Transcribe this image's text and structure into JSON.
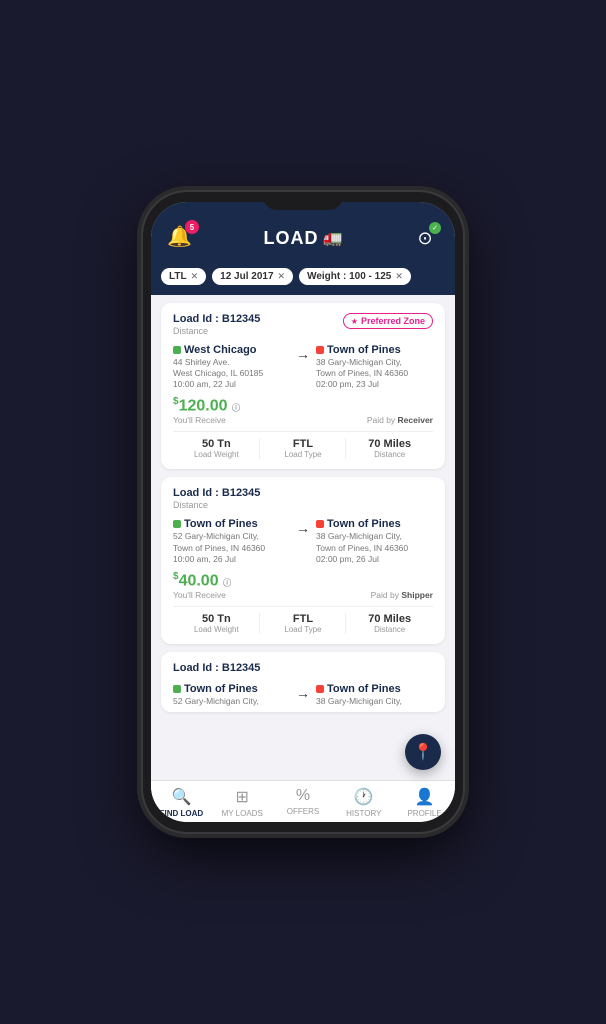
{
  "header": {
    "notification_count": "5",
    "logo_text": "LOAD",
    "filter_active": true
  },
  "filter_pills": [
    {
      "id": "ltl",
      "label": "LTL"
    },
    {
      "id": "date",
      "label": "12 Jul 2017"
    },
    {
      "id": "weight",
      "label": "Weight : 100 - 125"
    }
  ],
  "loads": [
    {
      "id": "load-1",
      "load_id_label": "Load Id : B12345",
      "distance_label": "Distance",
      "preferred_zone": true,
      "preferred_zone_label": "Preferred Zone",
      "origin": {
        "city": "West Chicago",
        "address_line1": "44 Shirley Ave.",
        "address_line2": "West Chicago, IL 60185",
        "time": "10:00 am, 22 Jul"
      },
      "destination": {
        "city": "Town of Pines",
        "address_line1": "38 Gary-Michigan City,",
        "address_line2": "Town of Pines, IN 46360",
        "time": "02:00 pm, 23 Jul"
      },
      "price": "120.00",
      "price_label": "You'll Receive",
      "paid_by": "Receiver",
      "weight": "50 Tn",
      "weight_label": "Load Weight",
      "load_type": "FTL",
      "load_type_label": "Load Type",
      "distance": "70 Miles"
    },
    {
      "id": "load-2",
      "load_id_label": "Load Id : B12345",
      "distance_label": "Distance",
      "preferred_zone": false,
      "origin": {
        "city": "Town of Pines",
        "address_line1": "52 Gary-Michigan City,",
        "address_line2": "Town of Pines, IN 46360",
        "time": "10:00 am, 26 Jul"
      },
      "destination": {
        "city": "Town of Pines",
        "address_line1": "38 Gary-Michigan City,",
        "address_line2": "Town of Pines, IN 46360",
        "time": "02:00 pm, 26 Jul"
      },
      "price": "40.00",
      "price_label": "You'll Receive",
      "paid_by": "Shipper",
      "weight": "50 Tn",
      "weight_label": "Load Weight",
      "load_type": "FTL",
      "load_type_label": "Load Type",
      "distance": "70 Miles"
    },
    {
      "id": "load-3",
      "load_id_label": "Load Id : B12345",
      "distance_label": "",
      "preferred_zone": false,
      "origin": {
        "city": "Town of Pines",
        "address_line1": "52 Gary-Michigan City,",
        "address_line2": "",
        "time": ""
      },
      "destination": {
        "city": "Town of Pines",
        "address_line1": "38 Gary-Michigan City,",
        "address_line2": "",
        "time": ""
      },
      "price": "",
      "price_label": "",
      "paid_by": "",
      "weight": "",
      "weight_label": "",
      "load_type": "",
      "load_type_label": "",
      "distance": ""
    }
  ],
  "nav": {
    "items": [
      {
        "id": "find-load",
        "label": "FIND LOAD",
        "icon": "🔍",
        "active": true
      },
      {
        "id": "my-loads",
        "label": "MY LOADS",
        "icon": "📦",
        "active": false
      },
      {
        "id": "offers",
        "label": "OFFERS",
        "icon": "%",
        "active": false
      },
      {
        "id": "history",
        "label": "HISTORY",
        "icon": "🕐",
        "active": false
      },
      {
        "id": "profile",
        "label": "PROFILE",
        "icon": "👤",
        "active": false
      }
    ]
  }
}
